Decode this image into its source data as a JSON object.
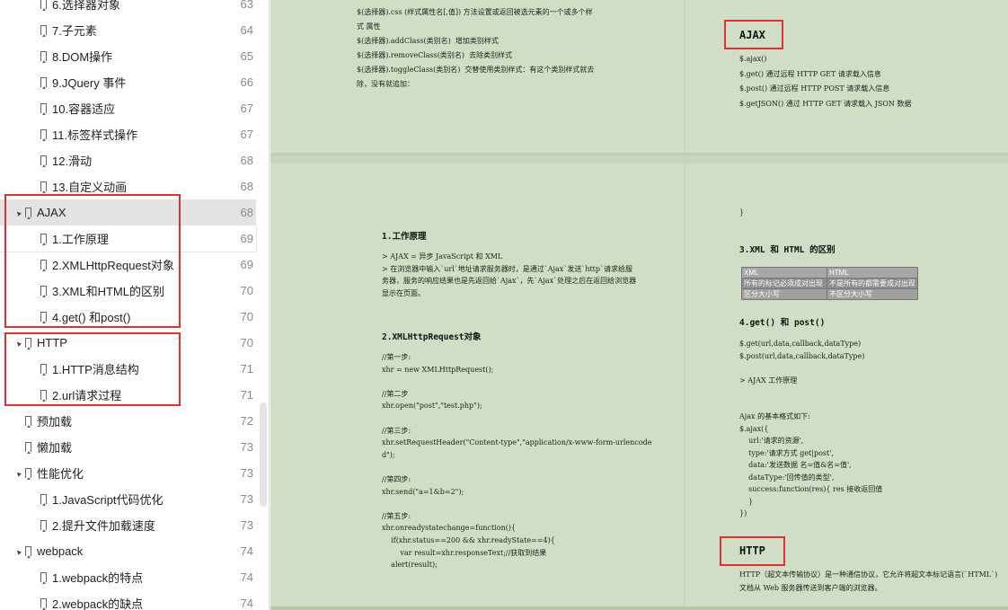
{
  "sidebar": {
    "items": [
      {
        "label": "6.选择器对象",
        "page": "63",
        "level": 1,
        "caret": ""
      },
      {
        "label": "7.子元素",
        "page": "64",
        "level": 1,
        "caret": ""
      },
      {
        "label": "8.DOM操作",
        "page": "65",
        "level": 1,
        "caret": ""
      },
      {
        "label": "9.JQuery 事件",
        "page": "66",
        "level": 1,
        "caret": ""
      },
      {
        "label": "10.容器适应",
        "page": "67",
        "level": 1,
        "caret": ""
      },
      {
        "label": "11.标签样式操作",
        "page": "67",
        "level": 1,
        "caret": ""
      },
      {
        "label": "12.滑动",
        "page": "68",
        "level": 1,
        "caret": ""
      },
      {
        "label": "13.自定义动画",
        "page": "68",
        "level": 1,
        "caret": ""
      },
      {
        "label": "AJAX",
        "page": "68",
        "level": 0,
        "caret": "▲",
        "selected": true
      },
      {
        "label": "1.工作原理",
        "page": "69",
        "level": 1,
        "caret": "",
        "hover": true
      },
      {
        "label": "2.XMLHttpRequest对象",
        "page": "69",
        "level": 1,
        "caret": ""
      },
      {
        "label": "3.XML和HTML的区别",
        "page": "70",
        "level": 1,
        "caret": ""
      },
      {
        "label": "4.get() 和post()",
        "page": "70",
        "level": 1,
        "caret": ""
      },
      {
        "label": "HTTP",
        "page": "70",
        "level": 0,
        "caret": "▲"
      },
      {
        "label": "1.HTTP消息结构",
        "page": "71",
        "level": 1,
        "caret": ""
      },
      {
        "label": "2.url请求过程",
        "page": "71",
        "level": 1,
        "caret": ""
      },
      {
        "label": "预加载",
        "page": "72",
        "level": 0,
        "caret": ""
      },
      {
        "label": "懒加载",
        "page": "73",
        "level": 0,
        "caret": ""
      },
      {
        "label": "性能优化",
        "page": "73",
        "level": 0,
        "caret": "▲"
      },
      {
        "label": "1.JavaScript代码优化",
        "page": "73",
        "level": 1,
        "caret": ""
      },
      {
        "label": "2.提升文件加载速度",
        "page": "73",
        "level": 1,
        "caret": ""
      },
      {
        "label": "webpack",
        "page": "74",
        "level": 0,
        "caret": "▲"
      },
      {
        "label": "1.webpack的特点",
        "page": "74",
        "level": 1,
        "caret": ""
      },
      {
        "label": "2.webpack的缺点",
        "page": "74",
        "level": 1,
        "caret": ""
      }
    ]
  },
  "doc": {
    "left_top_lines": [
      "$(选择器).css (样式属性名[,值]) 方法设置或返回被选元素的一个或多个样",
      "式 属性",
      "$(选择器).addClass(类别名)  增加类别样式",
      "$(选择器).removeClass(类别名)  去除类别样式",
      "$(选择器).toggleClass(类别名)  交替使用类别样式：有这个类别样式就去",
      "除，没有就追加："
    ],
    "ajax_heading": "AJAX",
    "ajax_lines": [
      "$.ajax()",
      "$.get() 通过远程 HTTP GET 请求载入信息",
      "$.post() 通过远程 HTTP POST 请求载入信息",
      "$.getJSON() 通过 HTTP GET 请求载入 JSON 数据"
    ],
    "sec1_title": "1.工作原理",
    "sec1_lines": [
      "> AJAX = 异步 JavaScript 和 XML",
      "> 在浏览器中输入`url`地址请求服务器时，是通过`Ajax`发送`http`请求给服",
      "务器，服务的响应结果也是先返回给`Ajax`，先`Ajax`处理之后在返回给浏览器",
      "显示在页面。"
    ],
    "sec2_title": "2.XMLHttpRequest对象",
    "sec2_lines": [
      "//第一步:",
      "xhr = new XMLHttpRequest();",
      "",
      "//第二步",
      "xhr.open(\"post\",\"test.php\");",
      "",
      "//第三步:",
      "xhr.setRequestHeader(\"Content-type\",\"application/x-www-form-urlencode",
      "d\");",
      "",
      "//第四步:",
      "xhr.send(\"a=1&b=2\");",
      "",
      "//第五步:",
      "xhr.onreadystatechange=function(){",
      "    if(xhr.status==200 && xhr.readyState==4){",
      "        var result=xhr.responseText;//获取到结果",
      "    alert(result);"
    ],
    "close_brace": "}",
    "sec3_title": "3.XML 和 HTML 的区别",
    "table": {
      "header": [
        "XML",
        "HTML"
      ],
      "rows": [
        [
          "所有的标记必须成对出现",
          "不是所有的都需要成对出现"
        ],
        [
          "区分大小写",
          "不区分大小写"
        ]
      ]
    },
    "sec4_title": "4.get() 和 post()",
    "sec4_lines": [
      "$.get(url,data,callback,dataType)",
      "$.post(url,data,callback,dataType)",
      "",
      "> AJAX 工作原理",
      "",
      "",
      "Ajax 的基本格式如下:",
      "$.ajax({",
      "    url:'请求的资源',",
      "    type:'请求方式 get|post',",
      "    data:'发送数据 名=值&名=值',",
      "    dataType:'回传值的类型',",
      "    success:function(res){ res 接收返回值",
      "    }",
      "})"
    ],
    "http_heading": "HTTP",
    "http_lines": [
      "HTTP（超文本传输协议）是一种通信协议，它允许将超文本标记语言(`HTML`)",
      "文档从 Web 服务器传送到客户端的浏览器。"
    ]
  },
  "colors": {
    "doc_background": "#c6d6bb",
    "highlight_box": "#e03030",
    "selected_row": "#e3e3e3"
  }
}
